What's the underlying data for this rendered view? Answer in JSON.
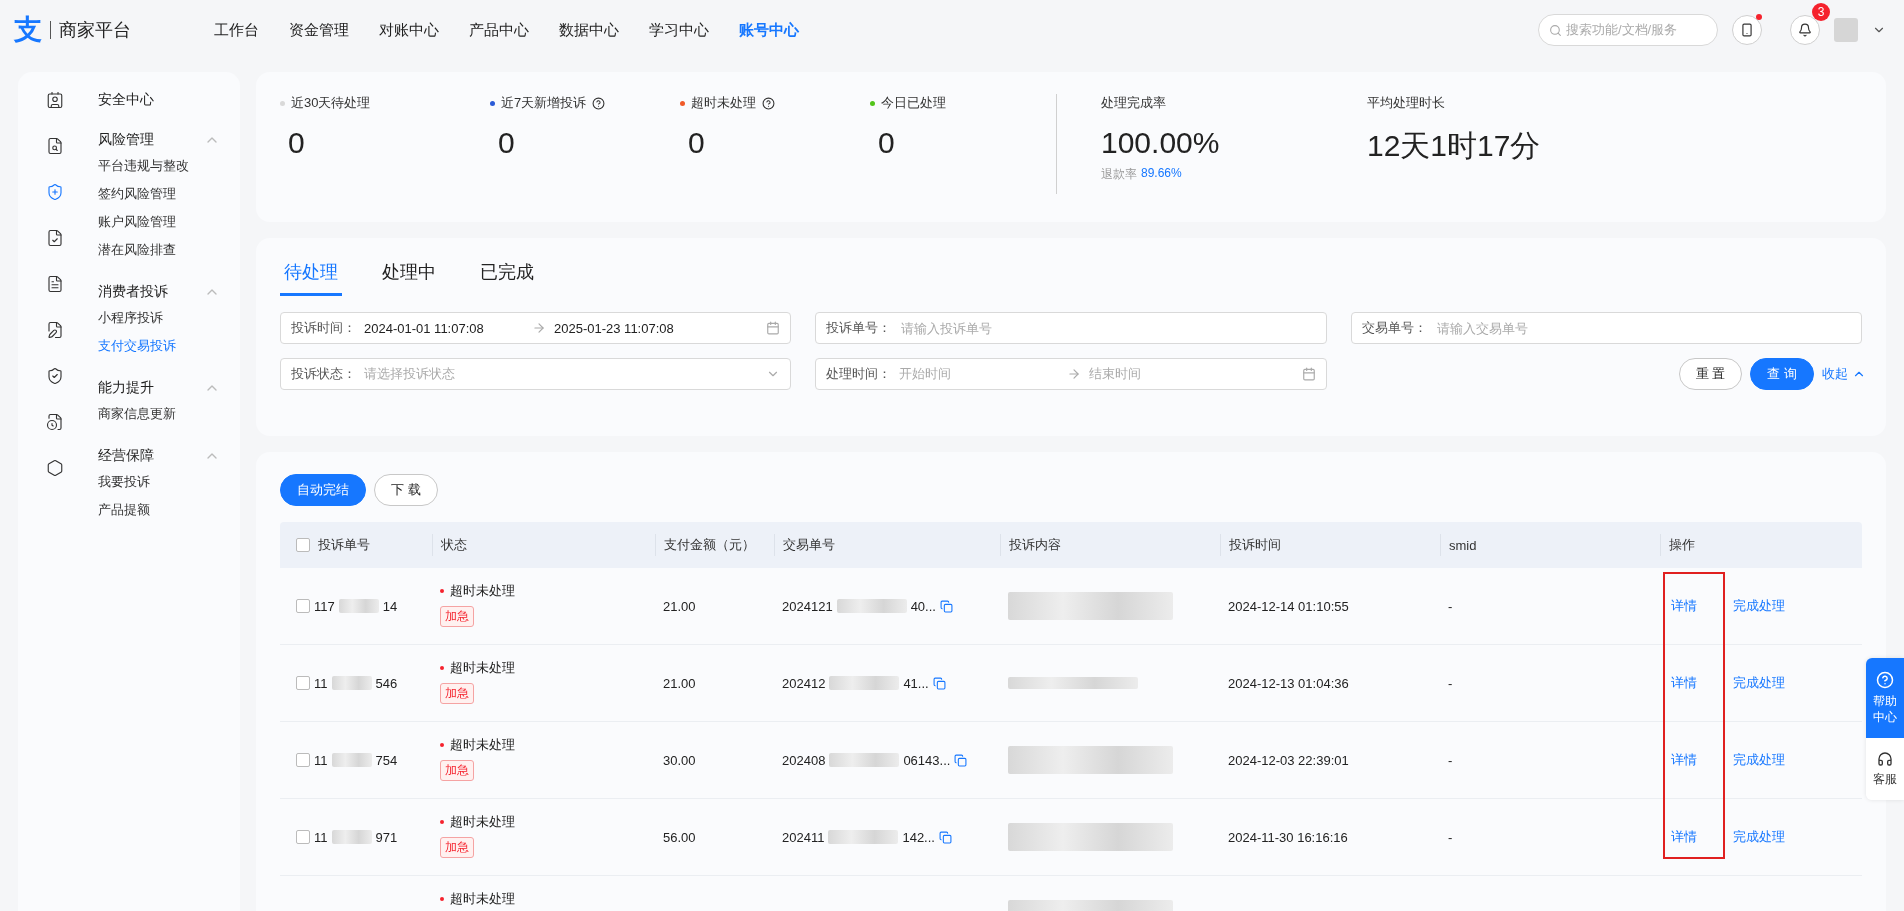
{
  "header": {
    "logo_mark": "支",
    "logo_text": "商家平台",
    "nav": [
      {
        "label": "工作台",
        "selected": false
      },
      {
        "label": "资金管理",
        "selected": false
      },
      {
        "label": "对账中心",
        "selected": false
      },
      {
        "label": "产品中心",
        "selected": false
      },
      {
        "label": "数据中心",
        "selected": false
      },
      {
        "label": "学习中心",
        "selected": false
      },
      {
        "label": "账号中心",
        "selected": true
      }
    ],
    "search": {
      "placeholder": "搜索功能/文档/服务"
    },
    "notification_count": "3"
  },
  "sidebar": {
    "items": [
      {
        "label": "安全中心"
      },
      {
        "label": "风险管理",
        "expanded": true,
        "children": [
          {
            "label": "平台违规与整改",
            "selected": false
          },
          {
            "label": "签约风险管理",
            "selected": false
          },
          {
            "label": "账户风险管理",
            "selected": false
          },
          {
            "label": "潜在风险排查",
            "selected": false
          }
        ]
      },
      {
        "label": "消费者投诉",
        "expanded": true,
        "children": [
          {
            "label": "小程序投诉",
            "selected": false
          },
          {
            "label": "支付交易投诉",
            "selected": true
          }
        ]
      },
      {
        "label": "能力提升",
        "expanded": true,
        "children": [
          {
            "label": "商家信息更新",
            "selected": false
          }
        ]
      },
      {
        "label": "经营保障",
        "expanded": true,
        "children": [
          {
            "label": "我要投诉",
            "selected": false
          },
          {
            "label": "产品提额",
            "selected": false
          }
        ]
      }
    ]
  },
  "stats": {
    "items": [
      {
        "label": "近30天待处理",
        "value": "0",
        "color": "#d9d9d9",
        "help": false
      },
      {
        "label": "近7天新增投诉",
        "value": "0",
        "color": "#2b5bd7",
        "help": true
      },
      {
        "label": "超时未处理",
        "value": "0",
        "color": "#f05a28",
        "help": true
      },
      {
        "label": "今日已处理",
        "value": "0",
        "color": "#52c41a",
        "help": false
      }
    ],
    "completion": {
      "label": "处理完成率",
      "value": "100.00%",
      "sub_label": "退款率",
      "sub_value": "89.66%"
    },
    "average": {
      "label": "平均处理时长",
      "value": "12天1时17分"
    }
  },
  "tabs": [
    {
      "label": "待处理",
      "selected": true
    },
    {
      "label": "处理中",
      "selected": false
    },
    {
      "label": "已完成",
      "selected": false
    }
  ],
  "filters": [
    {
      "kind": "range",
      "label": "投诉时间：",
      "start": "2024-01-01 11:07:08",
      "end": "2025-01-23 11:07:08"
    },
    {
      "kind": "text",
      "label": "投诉单号：",
      "placeholder": "请输入投诉单号"
    },
    {
      "kind": "text",
      "label": "交易单号：",
      "placeholder": "请输入交易单号"
    },
    {
      "kind": "select",
      "label": "投诉状态：",
      "placeholder": "请选择投诉状态"
    },
    {
      "kind": "range",
      "label": "处理时间：",
      "start_placeholder": "开始时间",
      "end_placeholder": "结束时间"
    }
  ],
  "filter_buttons": {
    "reset": "重 置",
    "query": "查 询",
    "collapse": "收起"
  },
  "table": {
    "buttons": [
      {
        "label": "自动完结",
        "kind": "primary"
      },
      {
        "label": "下 载",
        "kind": "default"
      }
    ],
    "columns": [
      "投诉单号",
      "状态",
      "支付金额（元）",
      "交易单号",
      "投诉内容",
      "投诉时间",
      "smid",
      "操作"
    ],
    "highlight_frame": true,
    "select_all_checked": false,
    "rows": [
      {
        "checked": false,
        "id_start": "117",
        "id_end": "14",
        "status": "超时未处理",
        "tag": "加急",
        "amount": "21.00",
        "trade_start": "2024121",
        "trade_end": "40...",
        "time": "2024-12-14 01:10:55",
        "smid": "-",
        "actions": [
          "详情",
          "完成处理"
        ]
      },
      {
        "checked": false,
        "id_start": "11",
        "id_end": "546",
        "status": "超时未处理",
        "tag": "加急",
        "amount": "21.00",
        "trade_start": "202412",
        "trade_end": "41...",
        "time": "2024-12-13 01:04:36",
        "smid": "-",
        "actions": [
          "详情",
          "完成处理"
        ]
      },
      {
        "checked": false,
        "id_start": "11",
        "id_end": "754",
        "status": "超时未处理",
        "tag": "加急",
        "amount": "30.00",
        "trade_start": "202408",
        "trade_end": "06143...",
        "time": "2024-12-03 22:39:01",
        "smid": "-",
        "actions": [
          "详情",
          "完成处理"
        ]
      },
      {
        "checked": false,
        "id_start": "11",
        "id_end": "971",
        "status": "超时未处理",
        "tag": "加急",
        "amount": "56.00",
        "trade_start": "202411",
        "trade_end": "142...",
        "time": "2024-11-30 16:16:16",
        "smid": "-",
        "actions": [
          "详情",
          "完成处理"
        ]
      },
      {
        "status": "超时未处理"
      }
    ]
  },
  "help_float": {
    "help": "帮助中心",
    "service": "客服"
  }
}
